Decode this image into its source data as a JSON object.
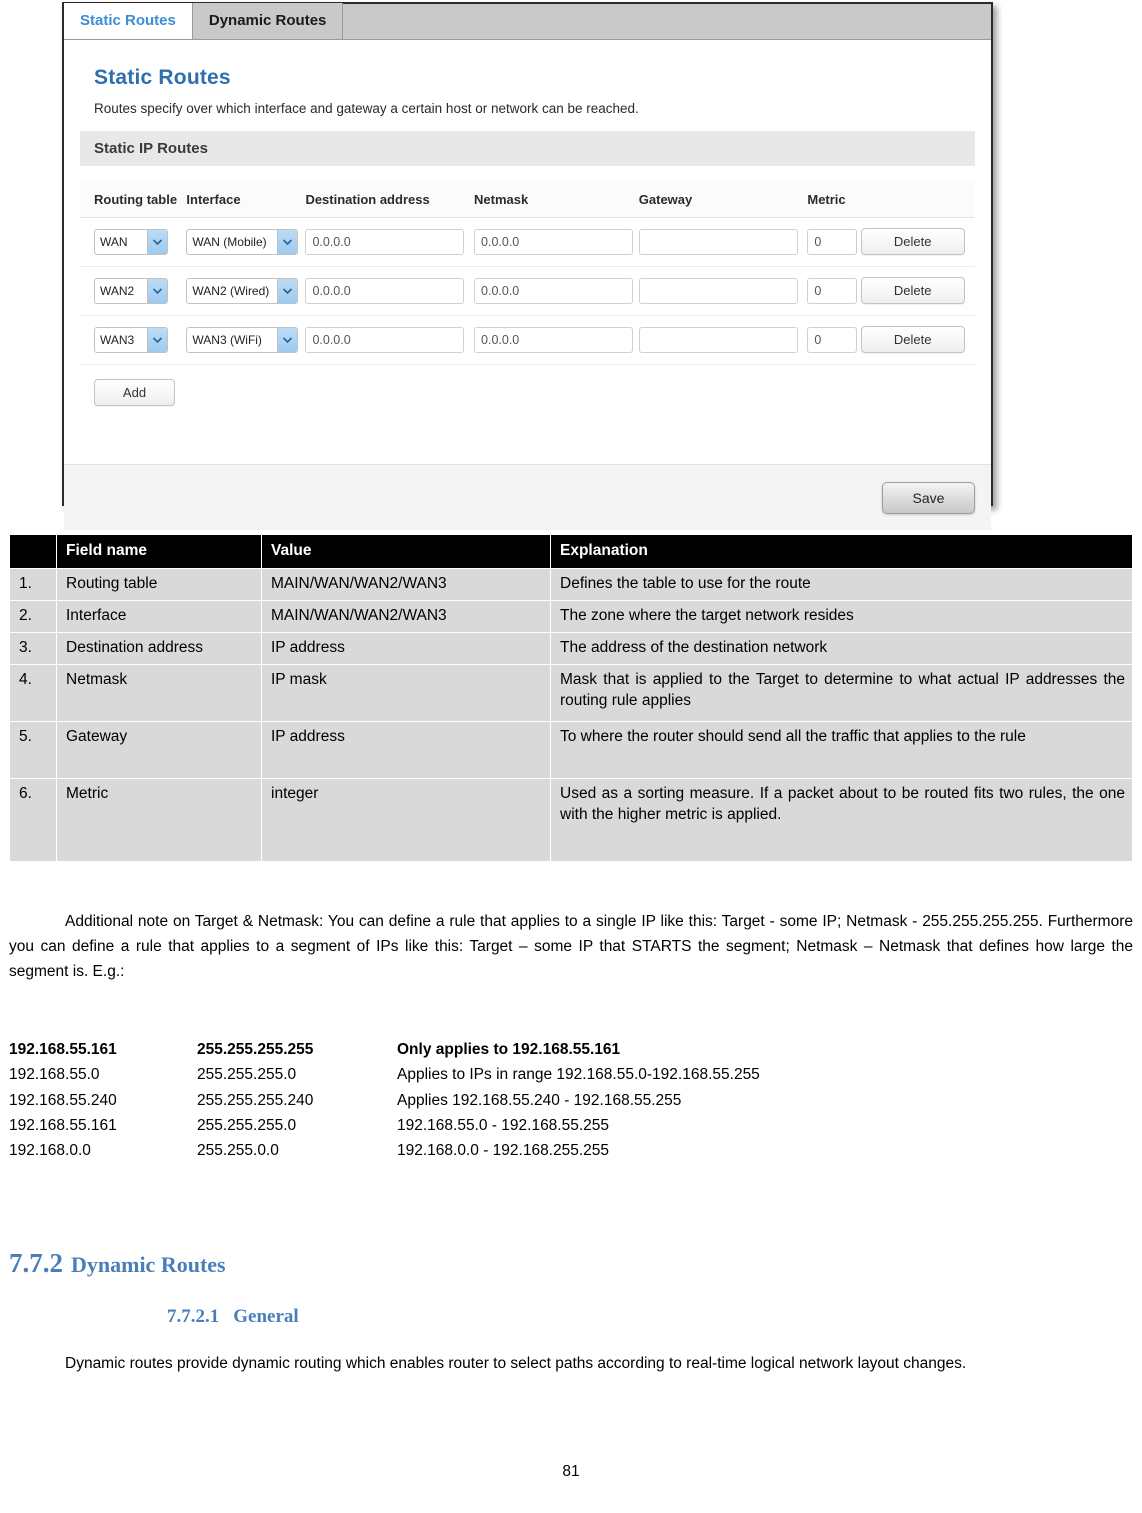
{
  "router_ui": {
    "tabs": [
      {
        "label": "Static Routes",
        "active": true
      },
      {
        "label": "Dynamic Routes",
        "active": false
      }
    ],
    "heading": "Static Routes",
    "subtitle": "Routes specify over which interface and gateway a certain host or network can be reached.",
    "section_title": "Static IP Routes",
    "columns": {
      "routing_table": "Routing table",
      "interface": "Interface",
      "destination": "Destination address",
      "netmask": "Netmask",
      "gateway": "Gateway",
      "metric": "Metric"
    },
    "rows": [
      {
        "routing_table": "WAN",
        "interface": "WAN (Mobile)",
        "destination": "0.0.0.0",
        "netmask": "0.0.0.0",
        "gateway": "",
        "metric": "0",
        "delete_label": "Delete"
      },
      {
        "routing_table": "WAN2",
        "interface": "WAN2 (Wired)",
        "destination": "0.0.0.0",
        "netmask": "0.0.0.0",
        "gateway": "",
        "metric": "0",
        "delete_label": "Delete"
      },
      {
        "routing_table": "WAN3",
        "interface": "WAN3 (WiFi)",
        "destination": "0.0.0.0",
        "netmask": "0.0.0.0",
        "gateway": "",
        "metric": "0",
        "delete_label": "Delete"
      }
    ],
    "add_label": "Add",
    "save_label": "Save",
    "accent_color": "#3b8fd6",
    "heading_color": "#2f6fad"
  },
  "doc_table": {
    "headers": [
      "",
      "Field name",
      "Value",
      "Explanation"
    ],
    "rows": [
      {
        "num": "1.",
        "field": "Routing table",
        "value": "MAIN/WAN/WAN2/WAN3",
        "explanation": "Defines the table to use for the route"
      },
      {
        "num": "2.",
        "field": "Interface",
        "value": "MAIN/WAN/WAN2/WAN3",
        "explanation": "The zone where the target network resides"
      },
      {
        "num": "3.",
        "field": "Destination address",
        "value": "IP address",
        "explanation": "The address of the destination network"
      },
      {
        "num": "4.",
        "field": "Netmask",
        "value": "IP mask",
        "explanation": "Mask that is applied to the Target to determine to what actual IP addresses the routing rule applies"
      },
      {
        "num": "5.",
        "field": "Gateway",
        "value": "IP address",
        "explanation": "To where the router should send all the traffic that applies to the rule"
      },
      {
        "num": "6.",
        "field": "Metric",
        "value": "integer",
        "explanation": "Used as a sorting measure. If a packet about to be routed fits two rules, the one with the higher metric is applied."
      }
    ]
  },
  "note_paragraph": "Additional note on Target & Netmask: You can define a rule that applies to a single IP like this: Target - some IP; Netmask - 255.255.255.255. Furthermore you can define a rule that applies to a segment of IPs like this: Target – some IP that STARTS the segment; Netmask – Netmask that defines how large the segment is. E.g.:",
  "ip_examples": [
    {
      "target": "192.168.55.161",
      "netmask": "255.255.255.255",
      "description": "Only applies to 192.168.55.161",
      "bold": true
    },
    {
      "target": "192.168.55.0",
      "netmask": "255.255.255.0",
      "description": "Applies to IPs in range 192.168.55.0-192.168.55.255",
      "bold": false
    },
    {
      "target": "192.168.55.240",
      "netmask": "255.255.255.240",
      "description": "Applies 192.168.55.240 -  192.168.55.255",
      "bold": false
    },
    {
      "target": "192.168.55.161",
      "netmask": "255.255.255.0",
      "description": "192.168.55.0 - 192.168.55.255",
      "bold": false
    },
    {
      "target": "192.168.0.0",
      "netmask": "255.255.0.0",
      "description": "192.168.0.0 - 192.168.255.255",
      "bold": false
    }
  ],
  "section_h2": {
    "number": "7.7.2",
    "title": "Dynamic Routes"
  },
  "section_h3": {
    "number": "7.7.2.1",
    "title": "General"
  },
  "dynamic_paragraph": "Dynamic routes provide dynamic routing which enables router to select paths according to real-time logical network layout changes.",
  "page_number": "81"
}
